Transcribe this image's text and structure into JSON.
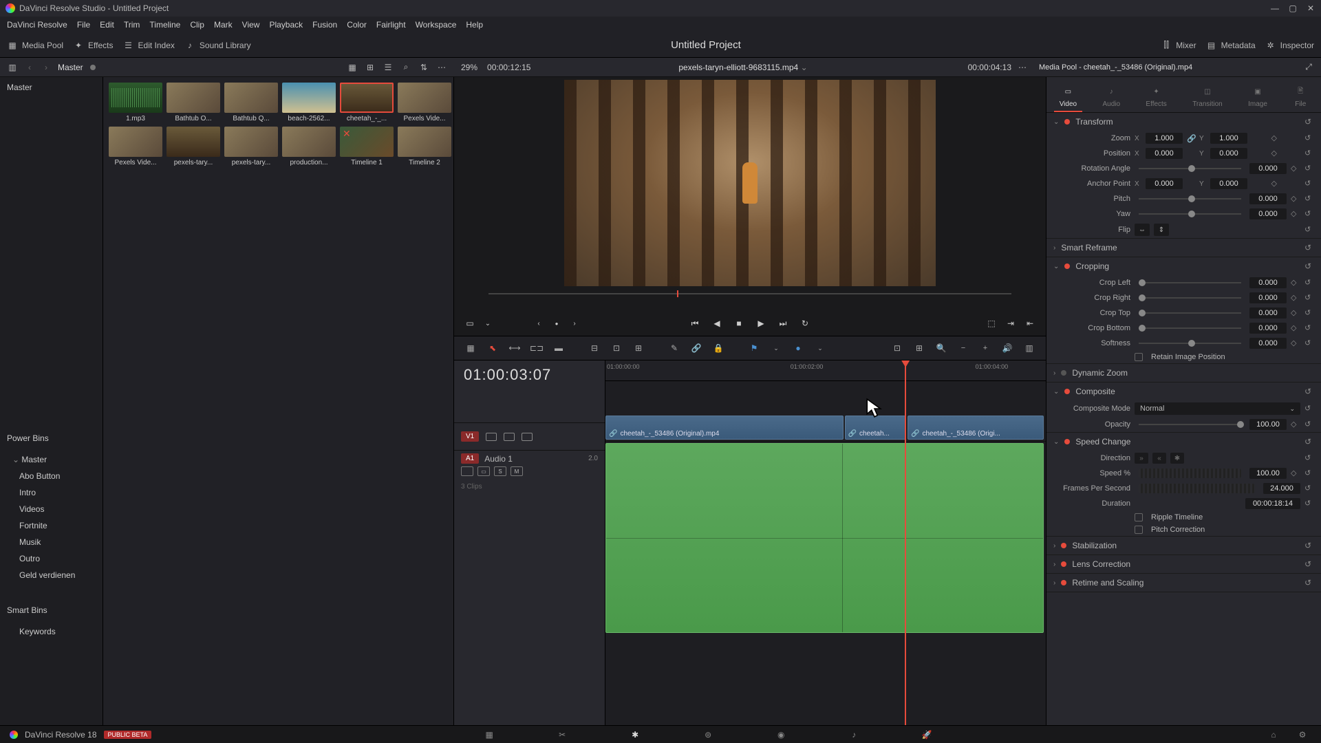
{
  "titlebar": {
    "app": "DaVinci Resolve Studio",
    "project": "Untitled Project"
  },
  "menu": [
    "DaVinci Resolve",
    "File",
    "Edit",
    "Trim",
    "Timeline",
    "Clip",
    "Mark",
    "View",
    "Playback",
    "Fusion",
    "Color",
    "Fairlight",
    "Workspace",
    "Help"
  ],
  "toolbar": {
    "media_pool": "Media Pool",
    "effects": "Effects",
    "edit_index": "Edit Index",
    "sound_library": "Sound Library",
    "project_title": "Untitled Project",
    "mixer": "Mixer",
    "metadata": "Metadata",
    "inspector": "Inspector"
  },
  "subheader": {
    "bin": "Master",
    "zoom": "29%",
    "source_tc": "00:00:12:15",
    "clip_name": "pexels-taryn-elliott-9683115.mp4",
    "record_tc": "00:00:04:13",
    "inspector_title": "Media Pool - cheetah_-_53486 (Original).mp4"
  },
  "bins": {
    "master": "Master",
    "power_label": "Power Bins",
    "power_master": "Master",
    "power_items": [
      "Abo Button",
      "Intro",
      "Videos",
      "Fortnite",
      "Musik",
      "Outro",
      "Geld verdienen"
    ],
    "smart_label": "Smart Bins",
    "smart_items": [
      "Keywords"
    ]
  },
  "thumbs": [
    {
      "label": "1.mp3",
      "cls": "audio-wave"
    },
    {
      "label": "Bathtub O...",
      "cls": "vid-thumb"
    },
    {
      "label": "Bathtub Q...",
      "cls": "vid-thumb"
    },
    {
      "label": "beach-2562...",
      "cls": "beach-thumb"
    },
    {
      "label": "cheetah_-_...",
      "cls": "forest-thumb",
      "selected": true
    },
    {
      "label": "Pexels Vide...",
      "cls": "vid-thumb"
    },
    {
      "label": "Pexels Vide...",
      "cls": "vid-thumb"
    },
    {
      "label": "pexels-tary...",
      "cls": "forest-thumb"
    },
    {
      "label": "pexels-tary...",
      "cls": "vid-thumb"
    },
    {
      "label": "production...",
      "cls": "vid-thumb"
    },
    {
      "label": "Timeline 1",
      "cls": "tl-thumb"
    },
    {
      "label": "Timeline 2",
      "cls": "vid-thumb"
    }
  ],
  "timeline": {
    "big_tc": "01:00:03:07",
    "ruler": [
      "01:00:00:00",
      "01:00:02:00",
      "01:00:04:00"
    ],
    "v1": "V1",
    "a1": "A1",
    "audio_name": "Audio 1",
    "audio_ch": "2.0",
    "clips_count": "3 Clips",
    "clip1": "cheetah_-_53486 (Original).mp4",
    "clip2": "cheetah...",
    "clip3": "cheetah_-_53486 (Origi..."
  },
  "inspector": {
    "tabs": [
      "Video",
      "Audio",
      "Effects",
      "Transition",
      "Image",
      "File"
    ],
    "transform": {
      "title": "Transform",
      "zoom": "Zoom",
      "zoom_x": "1.000",
      "zoom_y": "1.000",
      "position": "Position",
      "pos_x": "0.000",
      "pos_y": "0.000",
      "rotation": "Rotation Angle",
      "rotation_v": "0.000",
      "anchor": "Anchor Point",
      "anc_x": "0.000",
      "anc_y": "0.000",
      "pitch": "Pitch",
      "pitch_v": "0.000",
      "yaw": "Yaw",
      "yaw_v": "0.000",
      "flip": "Flip"
    },
    "smart_reframe": "Smart Reframe",
    "cropping": {
      "title": "Cropping",
      "left": "Crop Left",
      "left_v": "0.000",
      "right": "Crop Right",
      "right_v": "0.000",
      "top": "Crop Top",
      "top_v": "0.000",
      "bottom": "Crop Bottom",
      "bottom_v": "0.000",
      "soft": "Softness",
      "soft_v": "0.000",
      "retain": "Retain Image Position"
    },
    "dynamic_zoom": "Dynamic Zoom",
    "composite": {
      "title": "Composite",
      "mode_l": "Composite Mode",
      "mode_v": "Normal",
      "opacity_l": "Opacity",
      "opacity_v": "100.00"
    },
    "speed": {
      "title": "Speed Change",
      "direction": "Direction",
      "speed_pct": "Speed %",
      "speed_v": "100.00",
      "fps": "Frames Per Second",
      "fps_v": "24.000",
      "duration": "Duration",
      "duration_v": "00:00:18:14",
      "ripple": "Ripple Timeline",
      "pitch": "Pitch Correction"
    },
    "stabilization": "Stabilization",
    "lens": "Lens Correction",
    "retime": "Retime and Scaling"
  },
  "footer": {
    "version": "DaVinci Resolve 18",
    "beta": "PUBLIC BETA"
  }
}
